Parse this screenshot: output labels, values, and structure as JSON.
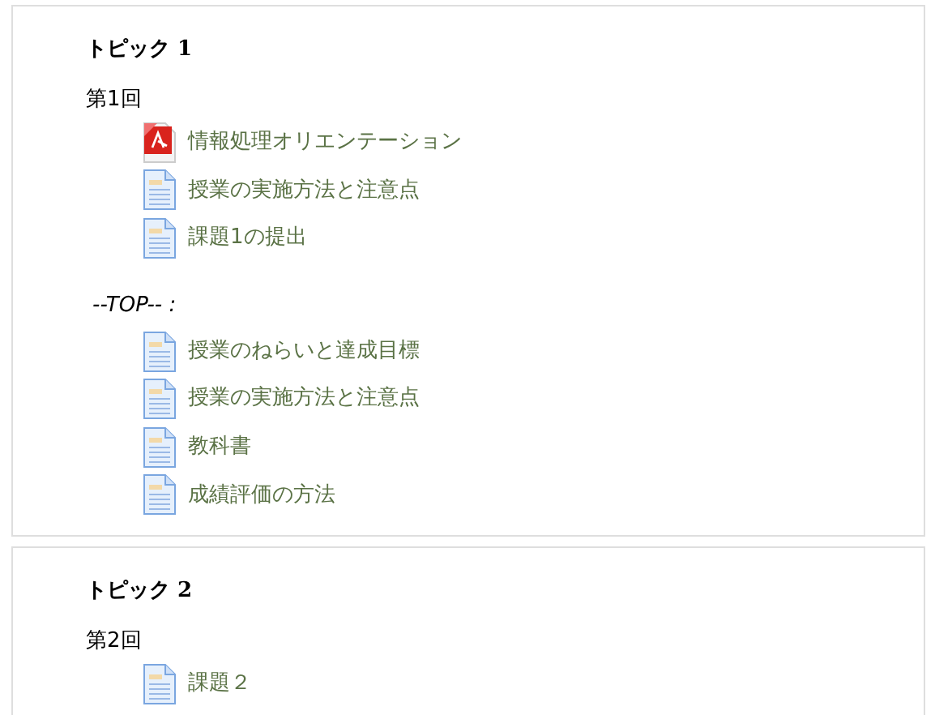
{
  "topics": [
    {
      "title": "トピック 1",
      "groups": [
        {
          "kind": "week",
          "label": "第1回",
          "items": [
            {
              "kind": "pdf",
              "label": "情報処理オリエンテーション"
            },
            {
              "kind": "doc",
              "label": "授業の実施方法と注意点"
            },
            {
              "kind": "doc",
              "label": "課題1の提出"
            }
          ]
        },
        {
          "kind": "note",
          "label": "--TOP-- :",
          "items": [
            {
              "kind": "doc",
              "label": "授業のねらいと達成目標"
            },
            {
              "kind": "doc",
              "label": "授業の実施方法と注意点"
            },
            {
              "kind": "doc",
              "label": "教科書"
            },
            {
              "kind": "doc",
              "label": "成績評価の方法"
            }
          ]
        }
      ]
    },
    {
      "title": "トピック 2",
      "groups": [
        {
          "kind": "week",
          "label": "第2回",
          "items": [
            {
              "kind": "doc",
              "label": "課題２"
            }
          ]
        }
      ]
    }
  ]
}
